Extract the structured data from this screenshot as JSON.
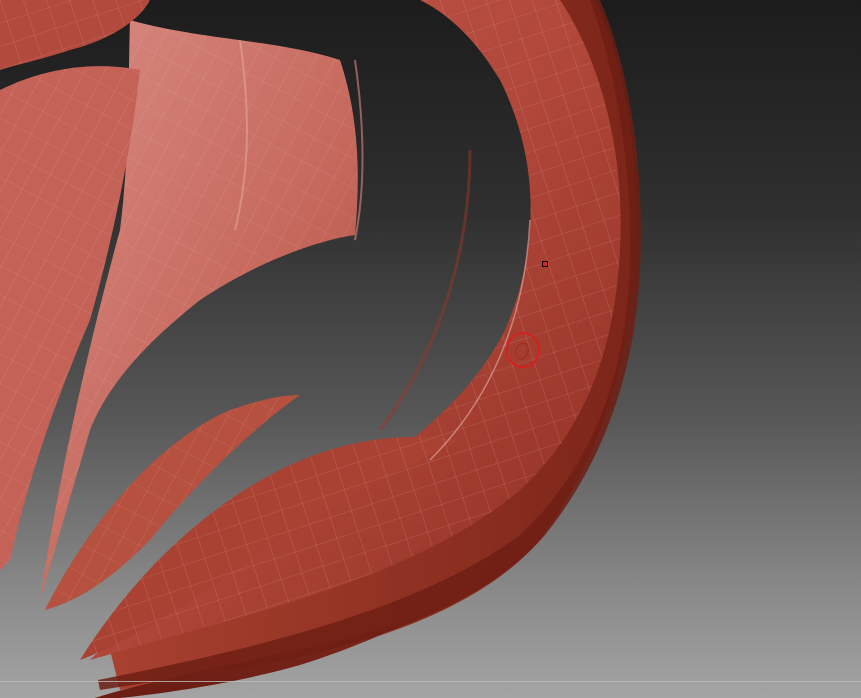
{
  "viewport": {
    "background_top_color": "#1c1c1c",
    "background_bottom_color": "#a4a4a4"
  },
  "mesh": {
    "material_color": "#b5493a",
    "highlight_color": "#d58d86",
    "shadow_color": "#7a2318",
    "wireframe_color": "#e7b7b0"
  },
  "brush": {
    "icon": "brush-ring-icon",
    "ring_color": "#e01a1a"
  },
  "pivot": {
    "icon": "focal-point-icon",
    "color": "#d12a1f"
  }
}
